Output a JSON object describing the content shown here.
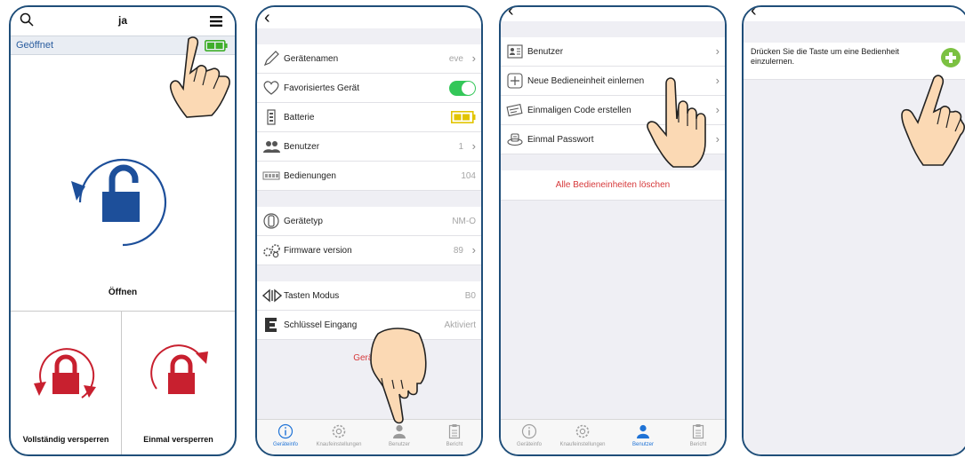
{
  "screen1": {
    "title": "ja",
    "status": "Geöffnet",
    "open_label": "Öffnen",
    "lock_full_label": "Vollständig versperren",
    "lock_once_label": "Einmal versperren",
    "icons": [
      "search-icon",
      "menu-icon",
      "battery-icon",
      "unlock-icon",
      "lock-icon"
    ],
    "colors": {
      "unlock": "#1d4f9a",
      "lock": "#c8202f",
      "battery": "#3fae2a"
    }
  },
  "screen2": {
    "rows": {
      "name": {
        "label": "Gerätenamen",
        "value": "eve"
      },
      "favorite": {
        "label": "Favorisiertes Gerät"
      },
      "battery": {
        "label": "Batterie"
      },
      "users": {
        "label": "Benutzer",
        "value": "1"
      },
      "operations": {
        "label": "Bedienungen",
        "value": "104"
      },
      "type": {
        "label": "Gerätetyp",
        "value": "NM-O"
      },
      "firmware": {
        "label": "Firmware version",
        "value": "89"
      },
      "keymode": {
        "label": "Tasten Modus",
        "value": "B0"
      },
      "keyinput": {
        "label": "Schlüssel Eingang",
        "value": "Aktiviert"
      }
    },
    "red_link": "Gerät lö",
    "colors": {
      "toggle": "#34c759",
      "battery": "#e2c400",
      "link": "#d6383a"
    }
  },
  "screen3": {
    "rows": {
      "users": {
        "label": "Benutzer"
      },
      "learn": {
        "label": "Neue Bedieneinheit einlernen"
      },
      "code": {
        "label": "Einmaligen Code erstellen"
      },
      "password": {
        "label": "Einmal Passwort"
      }
    },
    "red_link": "Alle Bedieneinheiten löschen"
  },
  "tabbar": {
    "deviceinfo": "Geräteinfo",
    "knob": "Knaufeinstellungen",
    "users": "Benutzer",
    "report": "Bericht",
    "active_color": "#1f73d6"
  },
  "screen4": {
    "info_text": "Drücken Sie die Taste um eine Bedienheit einzulernen.",
    "plus_color": "#7cc142"
  }
}
